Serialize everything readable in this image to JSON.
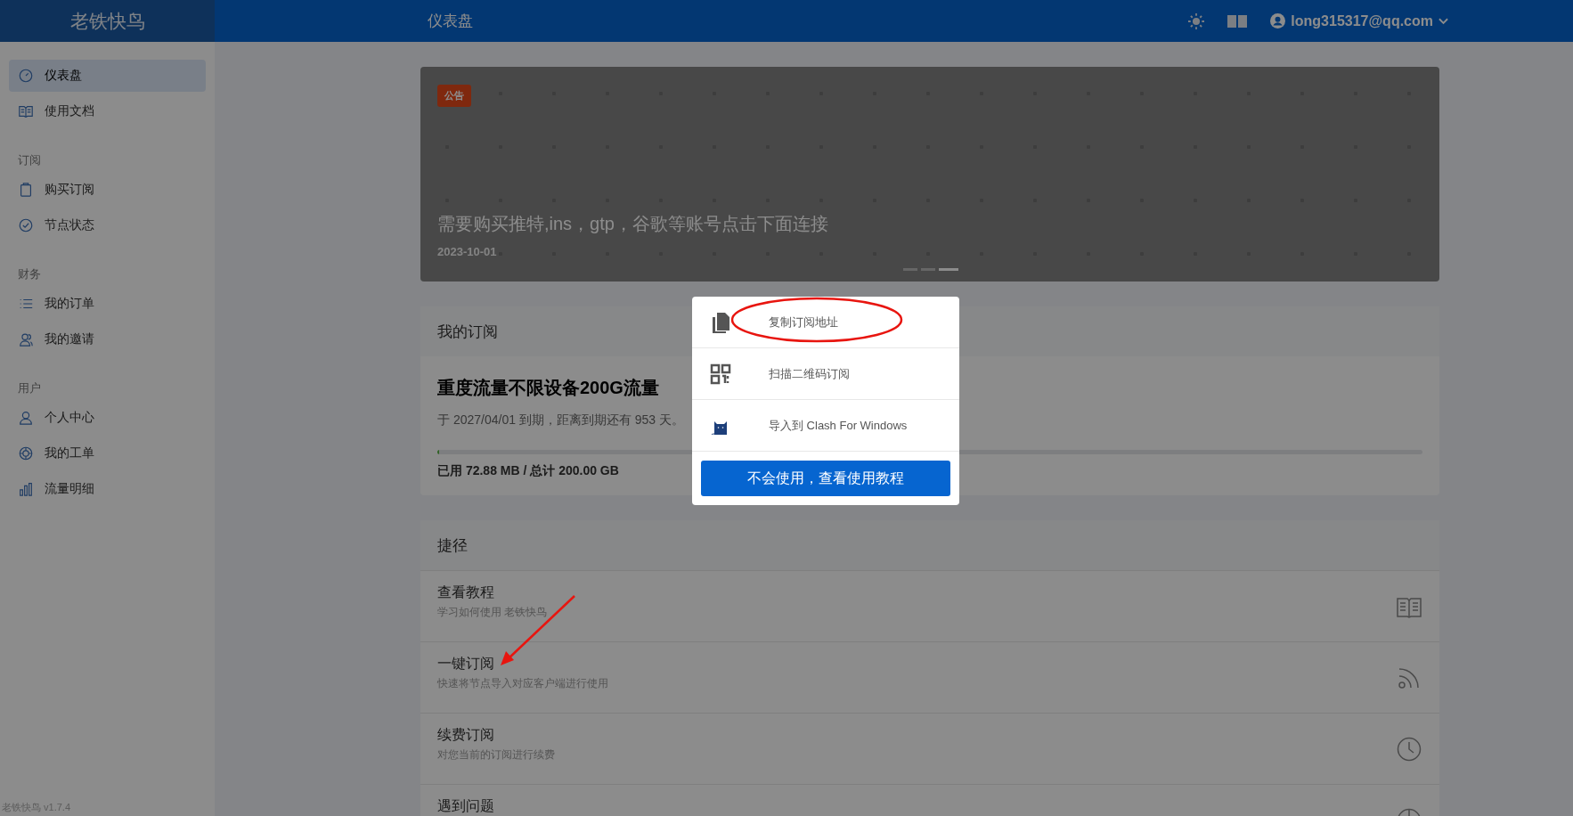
{
  "header": {
    "brand": "老铁快鸟",
    "page_title": "仪表盘",
    "user": "long315317@qq.com"
  },
  "sidebar": {
    "items": [
      {
        "kind": "item",
        "label": "仪表盘",
        "selected": true
      },
      {
        "kind": "item",
        "label": "使用文档",
        "selected": false
      },
      {
        "kind": "heading",
        "label": "订阅"
      },
      {
        "kind": "item",
        "label": "购买订阅",
        "selected": false
      },
      {
        "kind": "item",
        "label": "节点状态",
        "selected": false
      },
      {
        "kind": "heading",
        "label": "财务"
      },
      {
        "kind": "item",
        "label": "我的订单",
        "selected": false
      },
      {
        "kind": "item",
        "label": "我的邀请",
        "selected": false
      },
      {
        "kind": "heading",
        "label": "用户"
      },
      {
        "kind": "item",
        "label": "个人中心",
        "selected": false
      },
      {
        "kind": "item",
        "label": "我的工单",
        "selected": false
      },
      {
        "kind": "item",
        "label": "流量明细",
        "selected": false
      }
    ],
    "version": "老铁快鸟 v1.7.4"
  },
  "announcement": {
    "tag": "公告",
    "title": "需要购买推特,ins，gtp，谷歌等账号点击下面连接",
    "date": "2023-10-01",
    "slides": [
      {
        "selected": false
      },
      {
        "selected": false
      },
      {
        "selected": true
      }
    ]
  },
  "subscription": {
    "heading": "我的订阅",
    "plan": "重度流量不限设备200G流量",
    "expiry": "于 2027/04/01 到期，距离到期还有 953 天。",
    "level": 0.0004,
    "usage": "已用 72.88 MB / 总计 200.00 GB"
  },
  "shortcuts": {
    "heading": "捷径",
    "items": [
      {
        "title": "查看教程",
        "subtitle": "学习如何使用 老铁快鸟"
      },
      {
        "title": "一键订阅",
        "subtitle": "快速将节点导入对应客户端进行使用"
      },
      {
        "title": "续费订阅",
        "subtitle": "对您当前的订阅进行续费"
      },
      {
        "title": "遇到问题"
      }
    ]
  },
  "modal": {
    "items": [
      {
        "label": "复制订阅地址"
      },
      {
        "label": "扫描二维码订阅"
      },
      {
        "label": "导入到 Clash For Windows"
      }
    ],
    "button": "不会使用，查看使用教程"
  }
}
